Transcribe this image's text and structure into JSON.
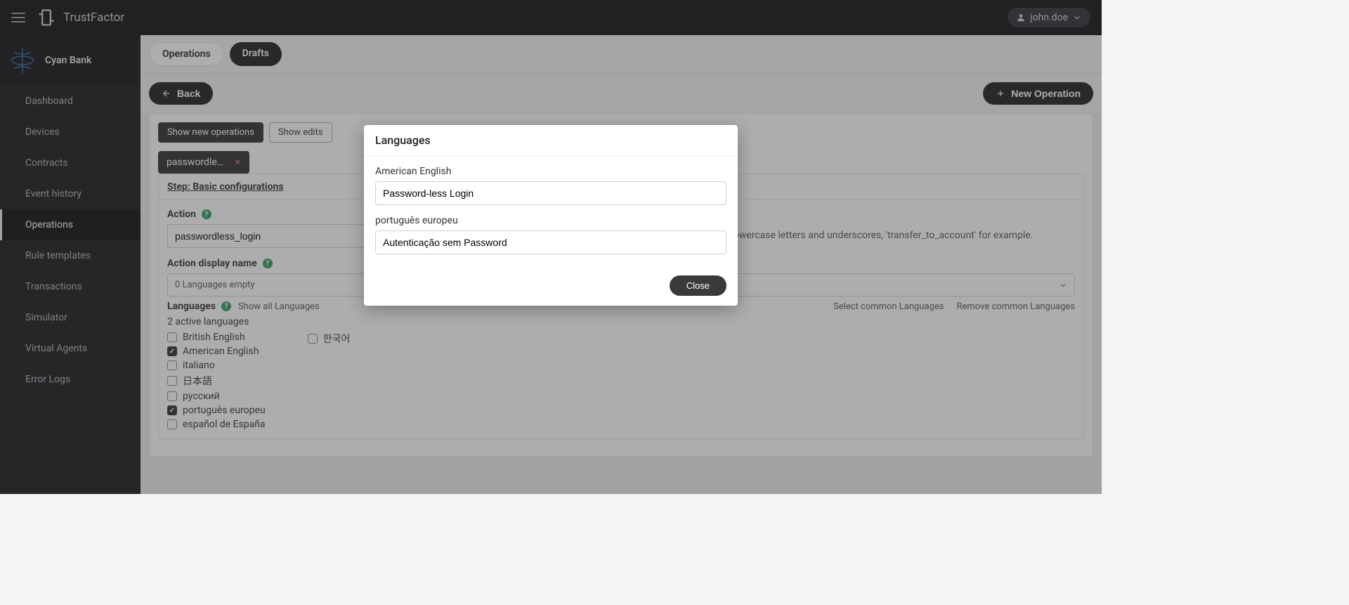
{
  "app": {
    "name": "TrustFactor"
  },
  "user": {
    "name": "john.doe"
  },
  "org": {
    "name": "Cyan Bank"
  },
  "sidebar": {
    "items": [
      {
        "label": "Dashboard"
      },
      {
        "label": "Devices"
      },
      {
        "label": "Contracts"
      },
      {
        "label": "Event history"
      },
      {
        "label": "Operations"
      },
      {
        "label": "Rule templates"
      },
      {
        "label": "Transactions"
      },
      {
        "label": "Simulator"
      },
      {
        "label": "Virtual Agents"
      },
      {
        "label": "Error Logs"
      }
    ],
    "activeIndex": 4
  },
  "tabs": {
    "operations": "Operations",
    "drafts": "Drafts"
  },
  "toolbar": {
    "back": "Back",
    "newOperation": "New Operation"
  },
  "filters": {
    "showNew": "Show new operations",
    "showEdits": "Show edits"
  },
  "openOperation": {
    "tabLabel": "passwordless_l…"
  },
  "step": {
    "title": "Step: Basic configurations",
    "action": {
      "label": "Action",
      "value": "passwordless_login",
      "hint": "Unique within this silo. Use lowercase letters and underscores, 'transfer_to_account' for example."
    },
    "displayName": {
      "label": "Action display name",
      "selected": "0 Languages empty"
    },
    "languages": {
      "label": "Languages",
      "showAll": "Show all Languages",
      "selectCommon": "Select common Languages",
      "removeCommon": "Remove common Languages",
      "activeCount": "2 active languages",
      "list": [
        {
          "label": "British English",
          "checked": false
        },
        {
          "label": "American English",
          "checked": true
        },
        {
          "label": "italiano",
          "checked": false
        },
        {
          "label": "日本語",
          "checked": false
        },
        {
          "label": "русский",
          "checked": false
        },
        {
          "label": "português europeu",
          "checked": true
        },
        {
          "label": "español de España",
          "checked": false
        }
      ],
      "list2": [
        {
          "label": "한국어",
          "checked": false
        }
      ]
    }
  },
  "modal": {
    "title": "Languages",
    "fields": [
      {
        "label": "American English",
        "value": "Password-less Login"
      },
      {
        "label": "português europeu",
        "value": "Autenticação sem Password"
      }
    ],
    "close": "Close"
  }
}
